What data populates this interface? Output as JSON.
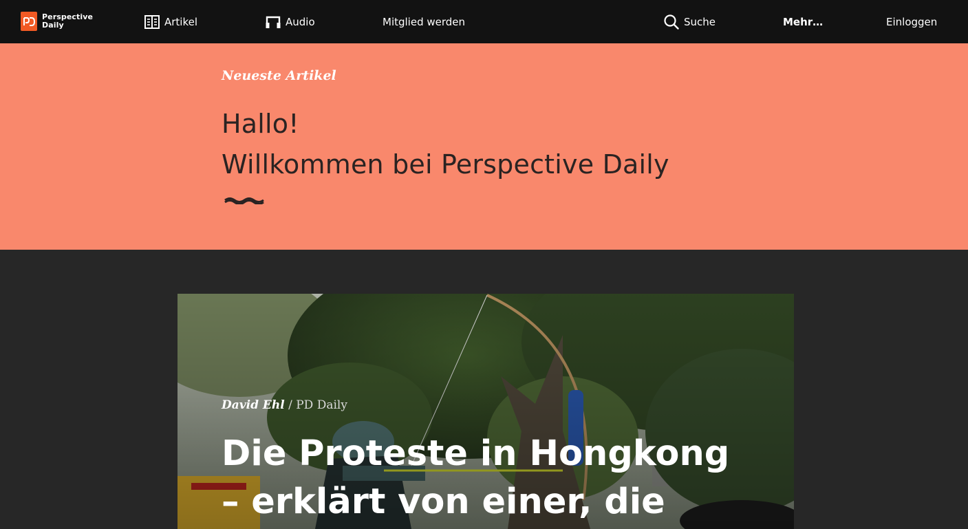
{
  "brand": {
    "name_line1": "Perspective",
    "name_line2": "Daily",
    "accent_color": "#f15a24"
  },
  "nav": {
    "artikel": "Artikel",
    "audio": "Audio",
    "membership": "Mitglied werden",
    "search": "Suche",
    "more": "Mehr…",
    "login": "Einloggen",
    "icons": {
      "artikel": "newspaper-icon",
      "audio": "headphones-icon",
      "search": "search-icon"
    }
  },
  "hero": {
    "kicker": "Neueste Artikel",
    "title_line1": "Hallo!",
    "title_line2": "Willkommen bei Perspective Daily",
    "background": "#f9886c"
  },
  "article": {
    "author": "David Ehl",
    "separator": "/",
    "section": "PD Daily",
    "title_line1": "Die Proteste in Hongkong",
    "title_line2": "– erklärt von einer, die",
    "image_subject": "protester-with-bow-photo"
  }
}
